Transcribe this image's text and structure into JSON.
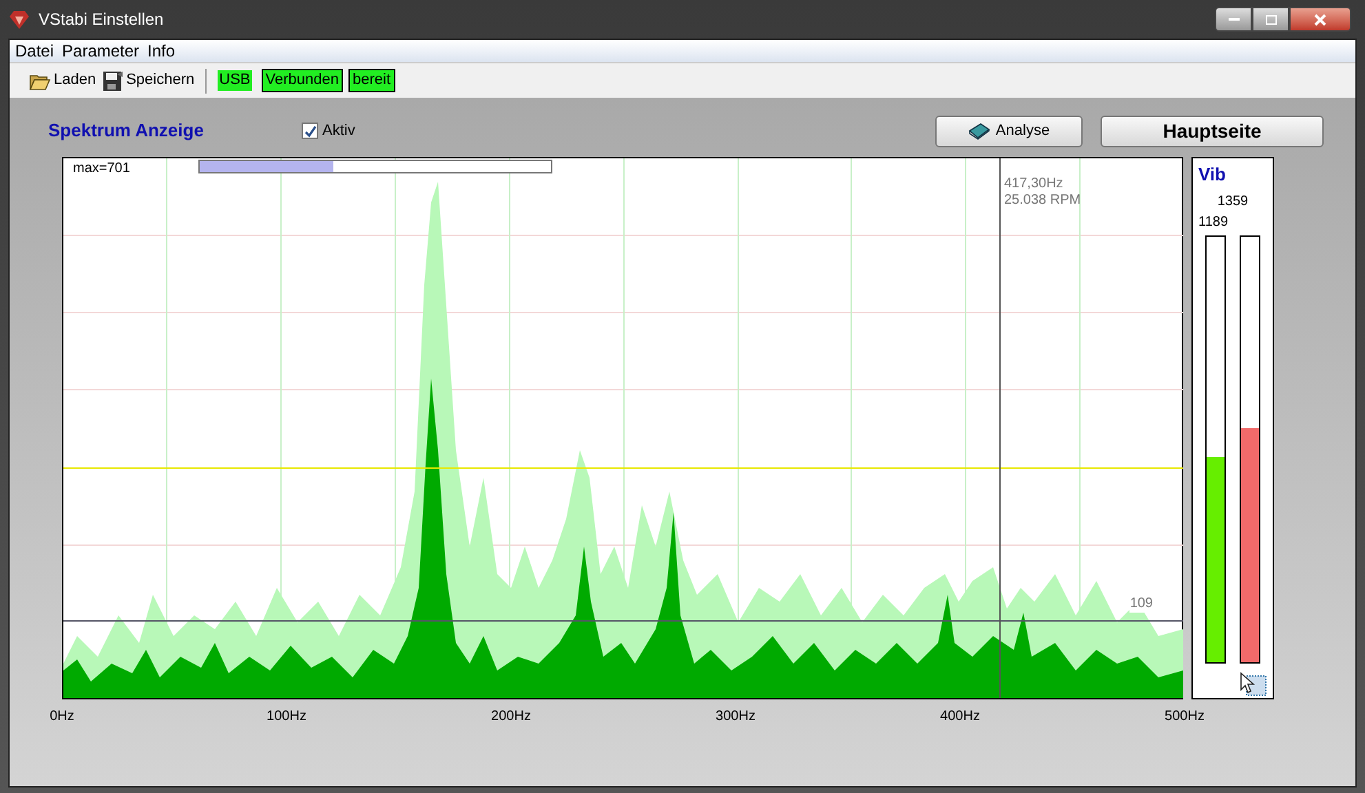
{
  "window": {
    "title": "VStabi Einstellen"
  },
  "menu": [
    "Datei",
    "Parameter",
    "Info"
  ],
  "toolbar": {
    "buttons": [
      {
        "label": "Laden",
        "kind": "open"
      },
      {
        "label": "Speichern",
        "kind": "save"
      }
    ],
    "status": [
      {
        "label": "USB",
        "kind": "plain"
      },
      {
        "label": "Verbunden",
        "kind": "boxed"
      },
      {
        "label": "bereit",
        "kind": "boxed"
      }
    ]
  },
  "spectrum": {
    "title": "Spektrum Anzeige",
    "active": {
      "label": "Aktiv",
      "checked": true
    },
    "max_label": "max=701",
    "level": 0.38,
    "cursor": {
      "frequency": "417,30Hz",
      "rpm": "25.038 RPM"
    },
    "threshold": "109",
    "x_labels": [
      "0Hz",
      "100Hz",
      "200Hz",
      "300Hz",
      "400Hz",
      "500Hz"
    ]
  },
  "buttons": [
    {
      "label": "Analyse",
      "kind": "book"
    },
    {
      "label": "Hauptseite",
      "kind": "plain"
    }
  ],
  "vib": {
    "title": "Vib",
    "value_1": "1359",
    "value_2": "1189",
    "bars": [
      {
        "level": 0.48,
        "color": "#66ee00"
      },
      {
        "level": 0.55,
        "color": "#f26a6a"
      }
    ]
  }
}
